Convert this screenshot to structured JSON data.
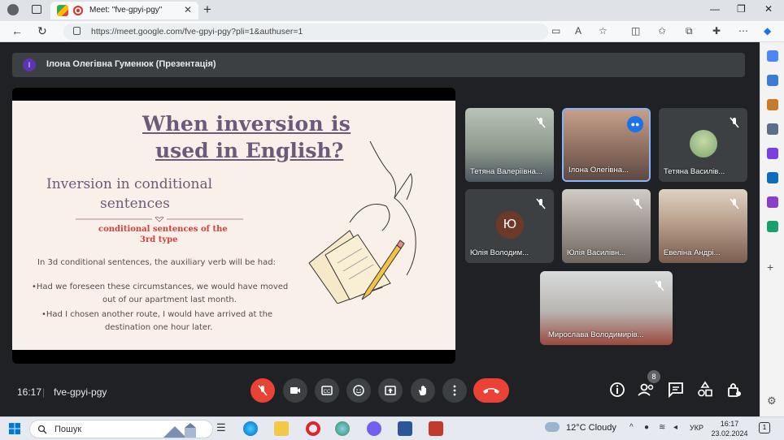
{
  "browser": {
    "tab_title": "Meet: \"fve-gpyi-pgy\"",
    "url": "https://meet.google.com/fve-gpyi-pgy?pli=1&authuser=1"
  },
  "presenter": {
    "initial": "I",
    "name": "Ілона Олегівна Гуменюк (Презентація)"
  },
  "slide": {
    "title_line1": "When inversion is",
    "title_line2": "used in English?",
    "heading_line1": "Inversion in conditional",
    "heading_line2": "sentences",
    "sub_line1": "conditional sentences of the",
    "sub_line2": "3rd type",
    "body1": "In 3d conditional sentences, the auxiliary verb will be had:",
    "ex1_line1": "•Had we foreseen these circumstances, we would have moved",
    "ex1_line2": "out of our apartment last month.",
    "ex2_line1": "•Had I chosen another route, I would have arrived at the",
    "ex2_line2": "destination one hour later."
  },
  "participants": [
    {
      "name": "Тетяна Валеріївна..."
    },
    {
      "name": "Ілона Олегівна..."
    },
    {
      "name": "Тетяна Василів..."
    },
    {
      "name": "Юлія Володим...",
      "initial": "Ю"
    },
    {
      "name": "Юлія Василівн..."
    },
    {
      "name": "Евеліна Андрі..."
    },
    {
      "name": "Мирослава Володимирів..."
    }
  ],
  "controls": {
    "time": "16:17",
    "separator": "|",
    "meeting_code": "fve-gpyi-pgy",
    "participant_count": "8"
  },
  "taskbar": {
    "search_placeholder": "Пошук",
    "weather": "12°C  Cloudy",
    "language": "УКР",
    "time": "16:17",
    "date": "23.02.2024"
  },
  "colors": {
    "meet_bg": "#202124",
    "tile_bg": "#3c4043",
    "hangup": "#ea4335",
    "slide_bg": "#faf0ea",
    "slide_title": "#6b5a78",
    "slide_red": "#d24040"
  }
}
